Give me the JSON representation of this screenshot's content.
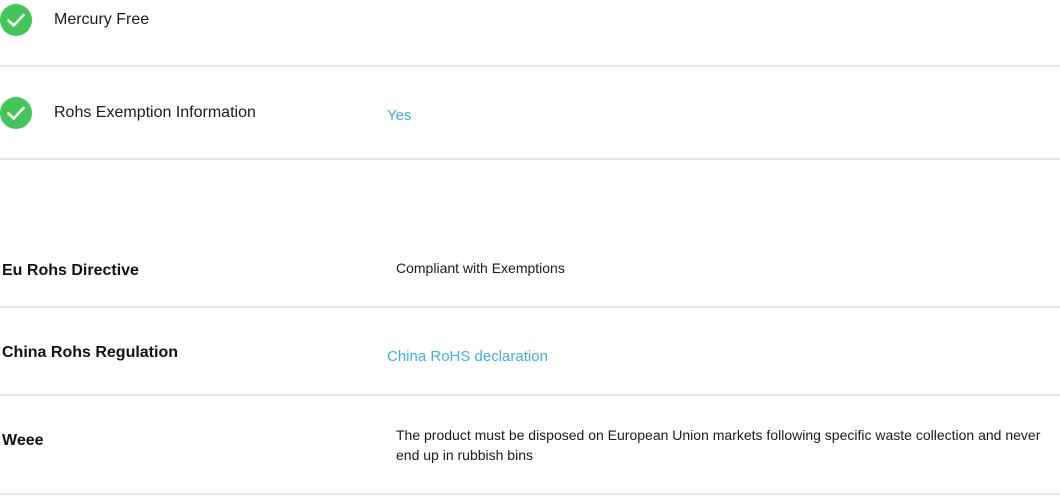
{
  "checks": [
    {
      "label": "Mercury Free",
      "value": "",
      "icon": "check-circle-icon"
    },
    {
      "label": "Rohs Exemption Information",
      "value": "Yes",
      "icon": "check-circle-icon"
    }
  ],
  "specs": [
    {
      "label": "Eu Rohs Directive",
      "value": "Compliant with Exemptions"
    },
    {
      "label": "China Rohs Regulation",
      "value": "China RoHS declaration"
    },
    {
      "label": "Weee",
      "value": "The product must be disposed on European Union markets following specific waste collection and never end up in rubbish bins"
    }
  ],
  "colors": {
    "check_green": "#42c65a",
    "link": "#3db1e3",
    "divider": "#e6e6e6"
  }
}
